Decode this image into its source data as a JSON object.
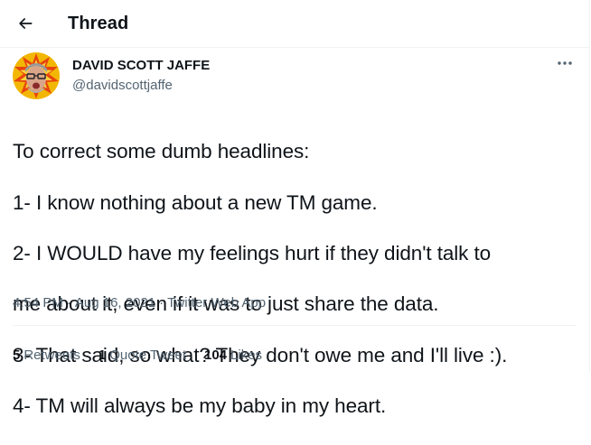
{
  "header": {
    "back_icon": "arrow-left-icon",
    "title": "Thread"
  },
  "tweet": {
    "author_name": "DAVID SCOTT JAFFE",
    "author_handle": "@davidscottjaffe",
    "more_icon": "more-horizontal-icon",
    "text_lines": [
      "To correct some dumb headlines:",
      "1- I know nothing about a new TM game.",
      "2- I WOULD have my feelings hurt if they didn't talk to",
      "me about it, even if it was to just share the data.",
      "3- That said, so what? They don't owe me and I'll live :).",
      "4- TM will always be my baby in my heart."
    ],
    "time": "4:54 PM",
    "date": "Aug 16, 2021",
    "source": "Twitter Web App",
    "separator": "·"
  },
  "stats": {
    "retweets": {
      "count": "5",
      "label": "Retweets"
    },
    "quote_tweets": {
      "count": "1",
      "label": "Quote Tweet"
    },
    "likes": {
      "count": "104",
      "label": "Likes"
    }
  },
  "colors": {
    "text_primary": "#0f1419",
    "text_secondary": "#536471",
    "border": "#eff3f4",
    "avatar_burst": "#f2b705",
    "avatar_burst_inner": "#e8440f"
  }
}
